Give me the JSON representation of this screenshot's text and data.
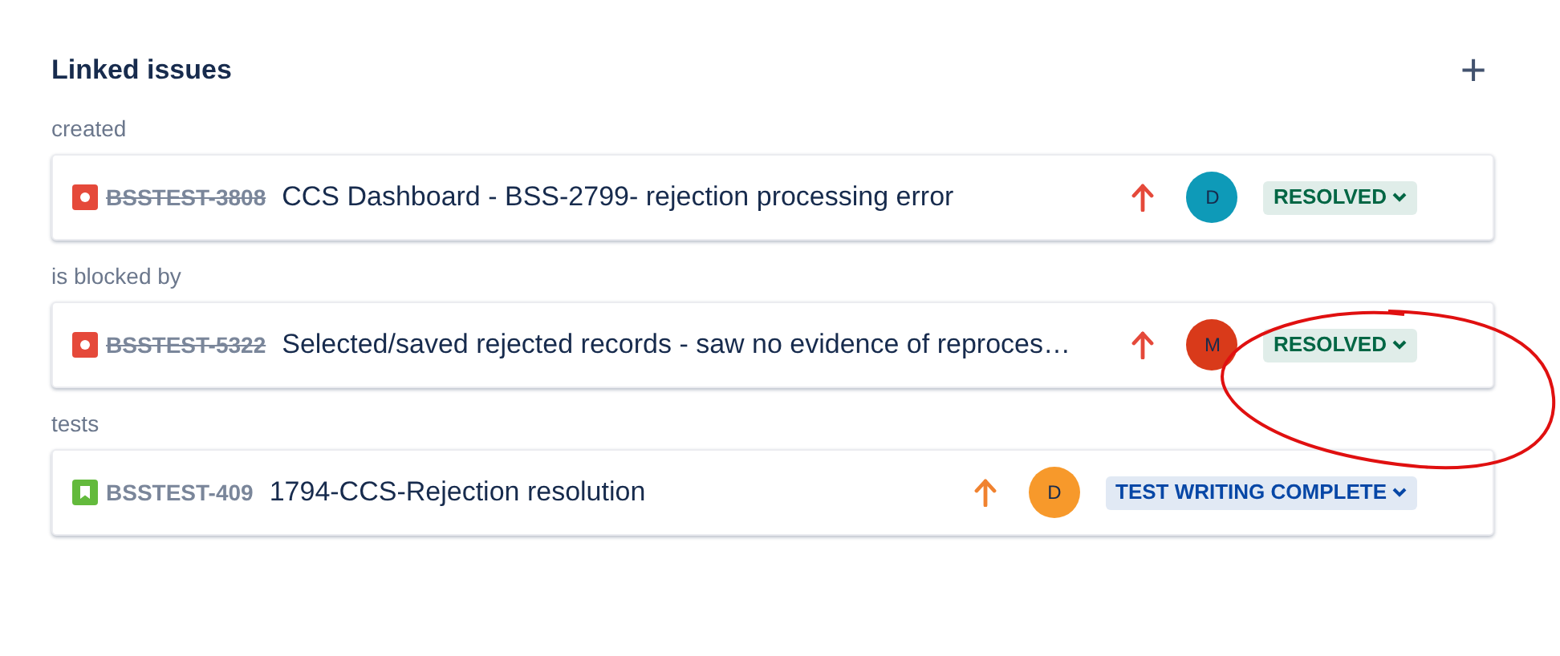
{
  "section": {
    "title": "Linked issues",
    "add_label": "+"
  },
  "groups": [
    {
      "label": "created",
      "issues": [
        {
          "kind": "bug",
          "key": "BSSTEST-3808",
          "resolved": true,
          "summary": "CCS Dashboard - BSS-2799- rejection processing error",
          "priority": {
            "color": "#e5493a"
          },
          "avatar": {
            "initial": "D",
            "color": "#0e9ab8"
          },
          "status": {
            "label": "RESOLVED",
            "color": "#006644"
          }
        }
      ]
    },
    {
      "label": "is blocked by",
      "issues": [
        {
          "kind": "bug",
          "key": "BSSTEST-5322",
          "resolved": true,
          "summary": "Selected/saved rejected records - saw no evidence of reproces…",
          "priority": {
            "color": "#e5493a"
          },
          "avatar": {
            "initial": "M",
            "color": "#d93a1a"
          },
          "status": {
            "label": "RESOLVED",
            "color": "#006644"
          }
        }
      ]
    },
    {
      "label": "tests",
      "issues": [
        {
          "kind": "story",
          "key": "BSSTEST-409",
          "resolved": false,
          "summary": "1794-CCS-Rejection resolution",
          "priority": {
            "color": "#f0822f"
          },
          "avatar": {
            "initial": "D",
            "color": "#f7992b"
          },
          "status": {
            "label": "TEST WRITING COMPLETE",
            "color": "#0747a6"
          }
        }
      ]
    }
  ],
  "annotation": {
    "kind": "circle"
  }
}
